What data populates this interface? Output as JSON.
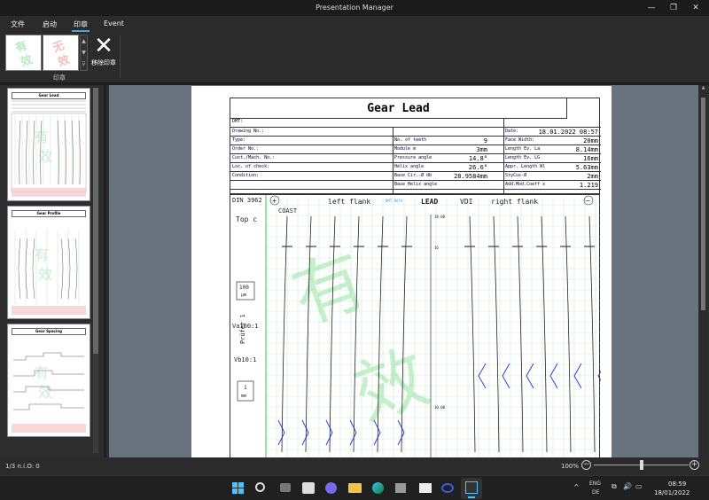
{
  "window": {
    "title": "Presentation Manager",
    "min_glyph": "—",
    "max_glyph": "❐",
    "close_glyph": "✕"
  },
  "menu": {
    "file": "文件",
    "start": "启动",
    "seal": "印章",
    "event": "Event"
  },
  "ribbon": {
    "stamp_thumb_1_chars": [
      "有",
      "效"
    ],
    "stamp_thumb_2_chars": [
      "无",
      "效"
    ],
    "remove_seal_label": "移除印章",
    "group_label": "印章",
    "gallery_arrows": [
      "▲",
      "▼",
      "⊽"
    ]
  },
  "thumbnails": [
    {
      "title": "Gear Lead"
    },
    {
      "title": "Gear Profile"
    },
    {
      "title": "Gear Spacing"
    }
  ],
  "report": {
    "title": "Gear Lead",
    "dmt_label": "DMT:",
    "rows": [
      {
        "a_label": "Drawing No.:",
        "b_label": "",
        "b_value": "",
        "c_label": "Date:",
        "c_value": "18.01.2022 08:57"
      },
      {
        "a_label": "Type:",
        "b_label": "No. of teeth",
        "b_value": "9",
        "c_label": "Face Width:",
        "c_value": "20mm"
      },
      {
        "a_label": "Order No.:",
        "b_label": "Module m",
        "b_value": "3mm",
        "c_label": "Length Ev. La",
        "c_value": "8.14mm"
      },
      {
        "a_label": "Cust./Mach. No.:",
        "b_label": "Pressure angle",
        "b_value": "14.8°",
        "c_label": "Length Ev. LG",
        "c_value": "16mm"
      },
      {
        "a_label": "Loc. of check:",
        "b_label": "Helix angle",
        "b_value": "26.6°",
        "c_label": "Appr. Length Wl",
        "c_value": "5.63mm"
      },
      {
        "a_label": "Condition:",
        "b_label": "Base Cir.-Ø db",
        "b_value": "28.9584mm",
        "c_label": "StyCus-Ø",
        "c_value": "2mm"
      },
      {
        "a_label": "",
        "b_label": "Base Helix angle",
        "b_value": "",
        "c_label": "Add.Mod.Coeff x",
        "c_value": "1.219"
      }
    ],
    "chart": {
      "standard": "DIN 3962",
      "coast": "COAST",
      "left_flank": "left flank",
      "lead": "LEAD",
      "vdi": "VDI",
      "right_flank": "right flank",
      "top": "Top c",
      "scale_top": "100",
      "scale_top_unit": "µm",
      "va": "Va100:1",
      "vb": "Vb10:1",
      "scale_bottom": "1",
      "scale_bottom_unit": "mm",
      "operator": "Prüfer 1",
      "plus": "+",
      "minus": "−",
      "tick_top": "18.00",
      "tick_mid": "16",
      "tick_low": "10.00",
      "small_note": "DMT DATA",
      "watermark": [
        "有",
        "效"
      ],
      "left_flank_tooth_count": 6,
      "right_flank_tooth_count": 6
    }
  },
  "status": {
    "page_info": "1/3 n.i.O: 0",
    "zoom": "100%",
    "zoom_level": 0.5,
    "zoom_minus": "−",
    "zoom_plus": "+"
  },
  "taskbar": {
    "lang_top": "ENG",
    "lang_bottom": "DE",
    "time": "08:59",
    "date": "18/01/2022",
    "tray_chevron": "^",
    "tray_glyphs": [
      "⧉",
      "🔊",
      "▭"
    ]
  }
}
